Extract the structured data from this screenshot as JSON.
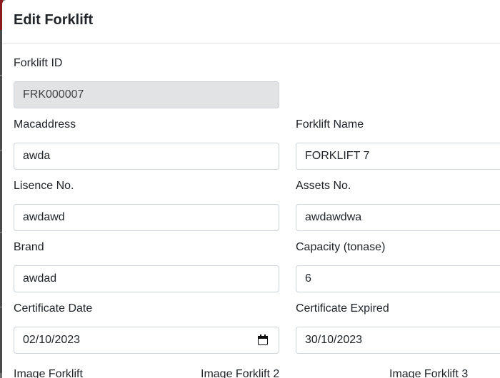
{
  "modal": {
    "title": "Edit Forklift"
  },
  "fields": {
    "forklift_id": {
      "label": "Forklift ID",
      "value": "FRK000007"
    },
    "macaddress": {
      "label": "Macaddress",
      "value": "awda"
    },
    "forklift_name": {
      "label": "Forklift Name",
      "value": "FORKLIFT 7"
    },
    "lisence_no": {
      "label": "Lisence No.",
      "value": "awdawd"
    },
    "assets_no": {
      "label": "Assets No.",
      "value": "awdawdwa"
    },
    "brand": {
      "label": "Brand",
      "value": "awdad"
    },
    "capacity": {
      "label": "Capacity (tonase)",
      "value": "6"
    },
    "certificate_date": {
      "label": "Certificate Date",
      "value": "02/10/2023",
      "icon": "calendar-icon"
    },
    "certificate_expired": {
      "label": "Certificate Expired",
      "value": "30/10/2023"
    }
  },
  "partial_labels": [
    "Image Forklift",
    "Image Forklift 2",
    "Image Forklift 3"
  ]
}
